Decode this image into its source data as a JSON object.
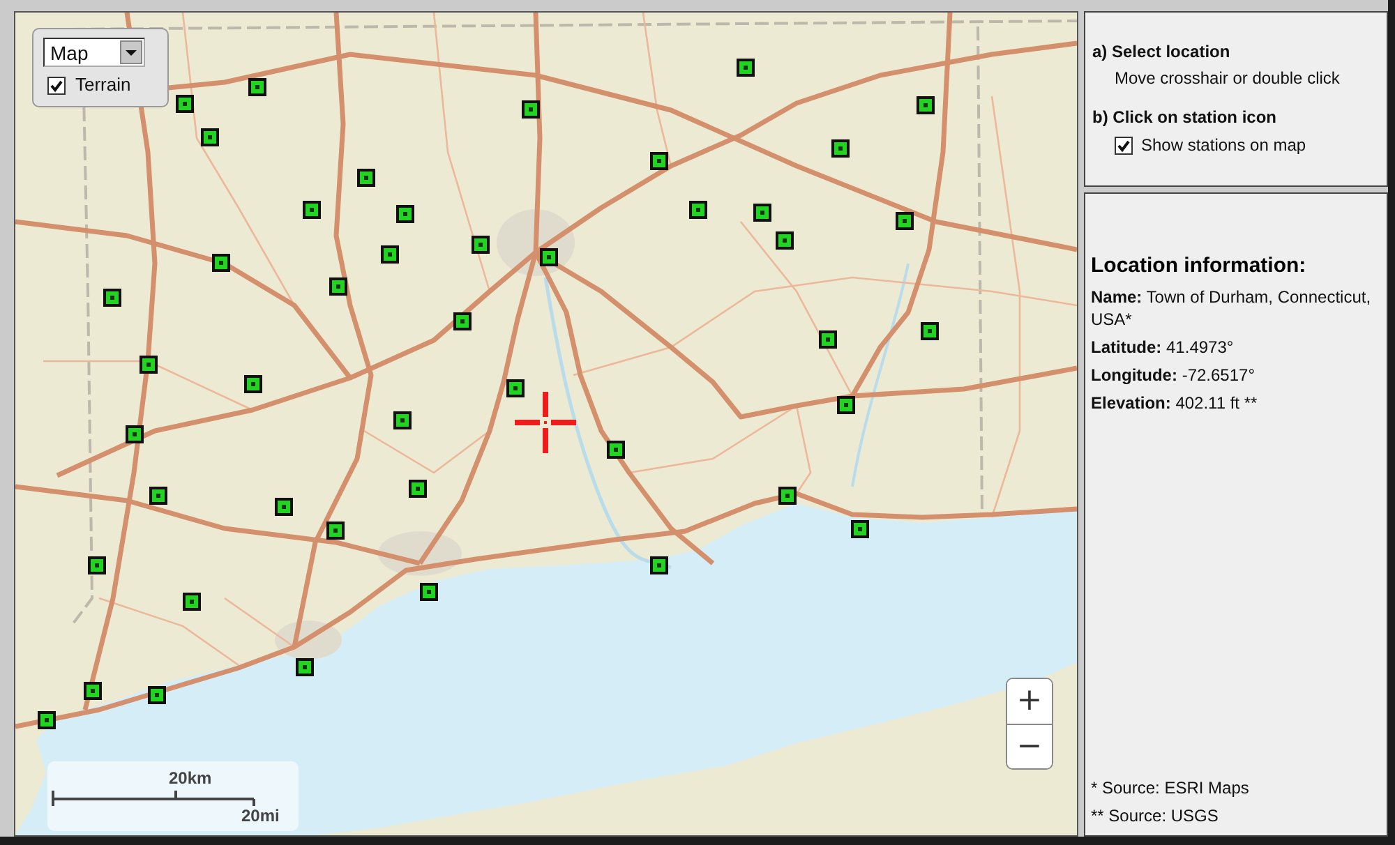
{
  "map": {
    "type_dropdown": {
      "value": "Map"
    },
    "terrain_checkbox": {
      "label": "Terrain",
      "checked": true
    },
    "zoom_buttons": [
      "+",
      "−"
    ],
    "scale_bar": {
      "metric_label": "20km",
      "imperial_label": "20mi"
    }
  },
  "instructions": {
    "step_a": {
      "title": "a) Select location",
      "hint": "Move crosshair or double click"
    },
    "step_b": {
      "title": "b) Click on station icon",
      "stations_checkbox": {
        "label": "Show stations on map",
        "checked": true
      }
    }
  },
  "location_info": {
    "heading": "Location information:",
    "fields": [
      {
        "label": "Name:",
        "value": "Town of Durham, Connecticut, USA*"
      },
      {
        "label": "Latitude:",
        "value": "41.4973°"
      },
      {
        "label": "Longitude:",
        "value": "-72.6517°"
      },
      {
        "label": "Elevation:",
        "value": "402.11 ft **"
      }
    ]
  },
  "sources": [
    "* Source: ESRI Maps",
    "** Source: USGS"
  ]
}
